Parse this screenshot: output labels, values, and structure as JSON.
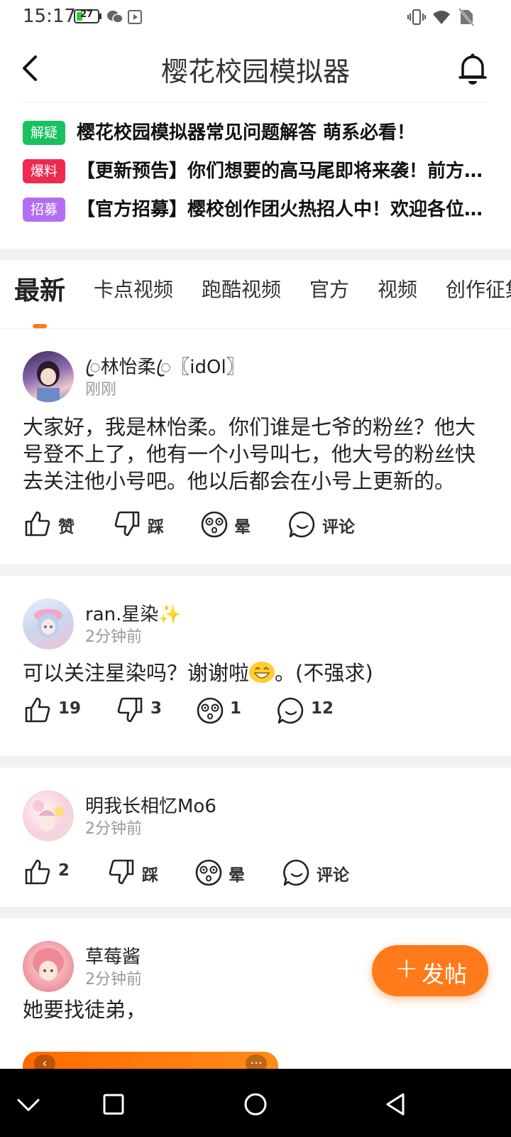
{
  "status_bar": {
    "time": "15:17",
    "battery": "27",
    "battery_level": 0.27
  },
  "header": {
    "title": "樱花校园模拟器"
  },
  "notices": [
    {
      "badge": "解疑",
      "color": "#18c160",
      "text": "樱花校园模拟器常见问题解答 萌系必看！"
    },
    {
      "badge": "爆料",
      "color": "#ee2a4f",
      "text": "【更新预告】你们想要的高马尾即将来袭！前方高能预警"
    },
    {
      "badge": "招募",
      "color": "#b26ef3",
      "text": "【官方招募】樱校创作团火热招人中！欢迎各位小伙伴加入"
    }
  ],
  "tabs": [
    "最新",
    "卡点视频",
    "跑酷视频",
    "官方",
    "视频",
    "创作征集"
  ],
  "posts": [
    {
      "user": "ꦿ林怡柔ꦿ〖idOl〗",
      "time": "刚刚",
      "body": "大家好，我是林怡柔。你们谁是七爷的粉丝？他大号登不上了，他有一个小号叫七，他大号的粉丝快去关注他小号吧。他以后都会在小号上更新的。",
      "actions": [
        "赞",
        "踩",
        "晕",
        "评论"
      ]
    },
    {
      "user": "ran.星染✨",
      "time": "2分钟前",
      "body_before": "可以关注星染吗？谢谢啦",
      "body_after": "。(不强求)",
      "actions": [
        "19",
        "3",
        "1",
        "12"
      ]
    },
    {
      "user": "明我长相忆Mo6",
      "time": "2分钟前",
      "actions": [
        "2",
        "踩",
        "晕",
        "评论"
      ]
    },
    {
      "user": "草莓酱",
      "time": "2分钟前",
      "body": "她要找徒弟，"
    }
  ],
  "fab": {
    "plus": "+",
    "label": "发帖"
  },
  "colors": {
    "accent": "#ff7a1a",
    "muted": "#999999",
    "gap": "#f1f1f1"
  },
  "icons": [
    "back-icon",
    "bell-icon",
    "like-icon",
    "dislike-icon",
    "dizzy-icon",
    "comment-icon"
  ]
}
